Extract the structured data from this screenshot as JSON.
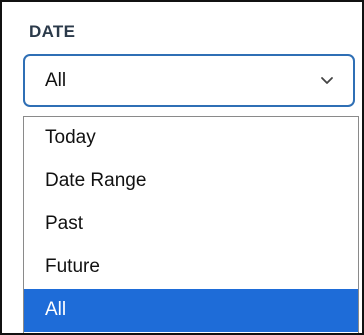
{
  "filter": {
    "label": "DATE",
    "selected_value": "All",
    "chevron_icon": "chevron-down-icon",
    "options": [
      {
        "label": "Today",
        "selected": false
      },
      {
        "label": "Date Range",
        "selected": false
      },
      {
        "label": "Past",
        "selected": false
      },
      {
        "label": "Future",
        "selected": false
      },
      {
        "label": "All",
        "selected": true
      }
    ]
  },
  "colors": {
    "focus_border": "#2f6fb5",
    "selected_option_bg": "#1e6cd8",
    "label_text": "#2b3a4a"
  }
}
